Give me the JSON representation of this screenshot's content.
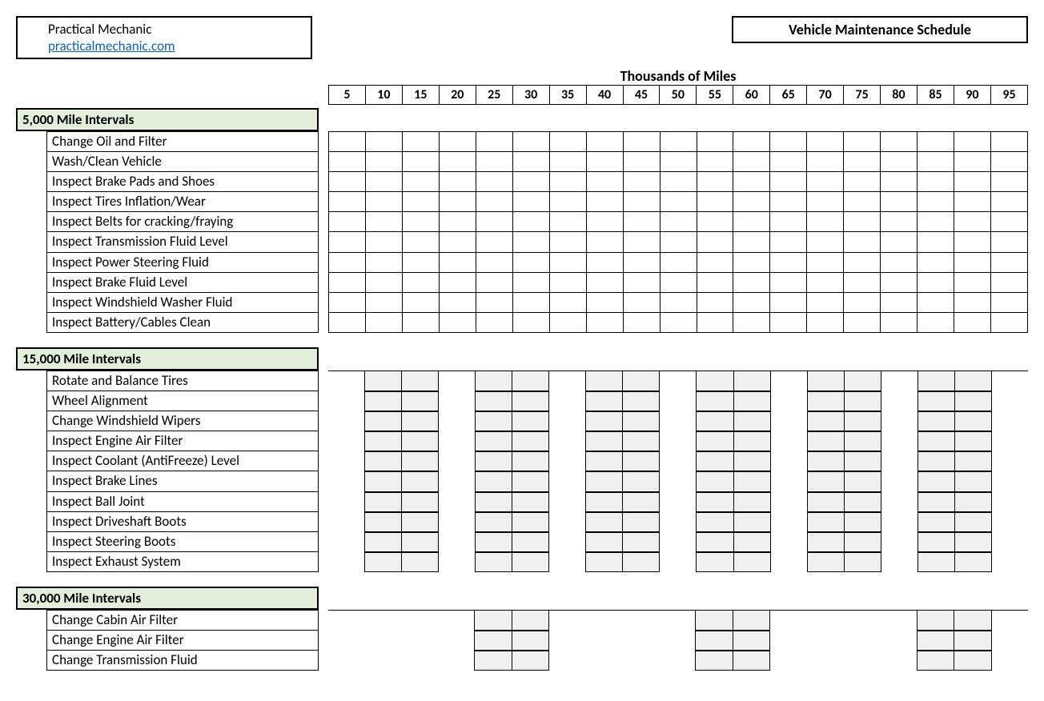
{
  "header": {
    "brand": "Practical Mechanic",
    "url": "practicalmechanic.com",
    "title": "Vehicle Maintenance Schedule",
    "miles_label": "Thousands of Miles",
    "miles": [
      "5",
      "10",
      "15",
      "20",
      "25",
      "30",
      "35",
      "40",
      "45",
      "50",
      "55",
      "60",
      "65",
      "70",
      "75",
      "80",
      "85",
      "90",
      "95"
    ]
  },
  "sections": [
    {
      "title": "5,000 Mile Intervals",
      "interval": 1,
      "tasks": [
        "Change Oil and Filter",
        "Wash/Clean Vehicle",
        "Inspect Brake Pads and Shoes",
        "Inspect Tires Inflation/Wear",
        "Inspect Belts for cracking/fraying",
        "Inspect Transmission Fluid Level",
        "Inspect Power Steering Fluid",
        "Inspect Brake Fluid Level",
        "Inspect Windshield Washer Fluid",
        "Inspect Battery/Cables Clean"
      ]
    },
    {
      "title": "15,000 Mile Intervals",
      "interval": 3,
      "tasks": [
        "Rotate and Balance Tires",
        "Wheel Alignment",
        "Change Windshield Wipers",
        "Inspect Engine Air Filter",
        "Inspect Coolant (AntiFreeze) Level",
        "Inspect Brake Lines",
        "Inspect Ball Joint",
        "Inspect Driveshaft Boots",
        "Inspect Steering Boots",
        "Inspect Exhaust System"
      ]
    },
    {
      "title": "30,000 Mile Intervals",
      "interval": 6,
      "tasks": [
        "Change Cabin Air Filter",
        "Change Engine Air Filter",
        "Change Transmission Fluid"
      ]
    }
  ]
}
